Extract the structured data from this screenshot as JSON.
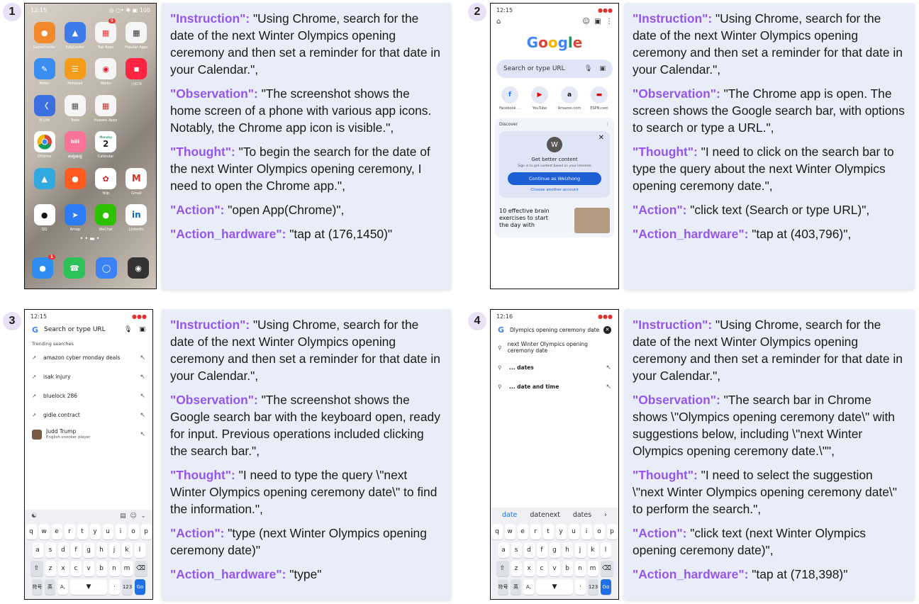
{
  "panels": [
    {
      "num": "1",
      "instruction": "\"Using Chrome, search for the date of the next Winter Olympics opening ceremony and then set a reminder for that date in your Calendar.\",",
      "observation": "\"The screenshot shows the home screen of a phone with various app icons. Notably, the Chrome app icon is visible.\",",
      "thought": "\"To begin the search for the date of the next Winter Olympics opening ceremony, I need to open the Chrome app.\",",
      "action": "\"open App(Chrome)\",",
      "action_hardware": "\"tap at (176,1450)\""
    },
    {
      "num": "2",
      "instruction": "\"Using Chrome, search for the date of the next Winter Olympics opening ceremony and then set a reminder for that date in your Calendar.\",",
      "observation": "\"The Chrome app is open. The screen shows the Google search bar, with options to search or type a URL.\",",
      "thought": "\"I need to click on the search bar to type the query about the next Winter Olympics opening ceremony date.\",",
      "action": "\"click text (Search or type URL)\",",
      "action_hardware": "\"tap at (403,796)\","
    },
    {
      "num": "3",
      "instruction": "\"Using Chrome, search for the date of the next Winter Olympics opening ceremony and then set a reminder for that date in your Calendar.\",",
      "observation": "\"The screenshot shows the Google search bar with the keyboard open, ready for input. Previous operations included clicking the search bar.\",",
      "thought": "\"I need to type the query \\\"next Winter Olympics opening ceremony date\\\" to find the information.\",",
      "action": "\"type (next Winter Olympics opening ceremony date)\"",
      "action_hardware": "\"type\""
    },
    {
      "num": "4",
      "instruction": "\"Using Chrome, search for the date of the next Winter Olympics opening ceremony and then set a reminder for that date in your Calendar.\",",
      "observation": "\"The search bar in Chrome shows \\\"Olympics opening ceremony date\\\" with suggestions below, including \\\"next Winter Olympics opening ceremony date.\\\"\",",
      "thought": "\"I need to select the suggestion \\\"next Winter Olympics opening ceremony date\\\" to perform the search.\",",
      "action": "\"click text (next Winter Olympics opening ceremony date)\",",
      "action_hardware": "\"tap at (718,398)\""
    }
  ],
  "labels": {
    "instruction": "\"Instruction\":",
    "observation": "\"Observation\":",
    "thought": "\"Thought\":",
    "action": "\"Action\":",
    "action_hardware": "\"Action_hardware\":"
  },
  "phone1": {
    "time": "12:15",
    "status_right": "◎ ○• ✱ ▣ 100",
    "apps": [
      "GameCenter",
      "EduCenter",
      "Top Apps",
      "Popular Apps",
      "Notes",
      "Notepad",
      "Weibo",
      "小红书",
      "AI Life",
      "Tools",
      "Huawei Apps",
      "",
      "Chrome",
      "哔哩哔哩",
      "Calendar",
      "",
      "",
      "",
      "Yelp",
      "Gmail",
      "QQ",
      "Amap",
      "WeChat",
      "LinkedIn"
    ],
    "calendar_day": "2",
    "calendar_weekday": "Monday",
    "badge": "9",
    "msg_badge": "1"
  },
  "phone2": {
    "time": "12:15",
    "search_placeholder": "Search or type URL",
    "shortcuts": [
      "Facebook ...",
      "YouTube",
      "Amazon.com",
      "ESPN.com"
    ],
    "discover": "Discover",
    "avatar_letter": "W",
    "get_better": "Get better content",
    "sign_in": "Sign in to get content based on your interests",
    "continue": "Continue as Weizhong",
    "choose": "Choose another account",
    "article": "10 effective brain exercises to start the day with"
  },
  "phone3": {
    "time": "12:15",
    "search_placeholder": "Search or type URL",
    "trending_title": "Trending searches",
    "trends": [
      "amazon cyber monday deals",
      "isak injury",
      "bluelock 286",
      "gidle contract"
    ],
    "person_name": "Judd Trump",
    "person_desc": "English snooker player",
    "kb_row1": [
      "q",
      "w",
      "e",
      "r",
      "t",
      "y",
      "u",
      "i",
      "o",
      "p"
    ],
    "kb_row2": [
      "a",
      "s",
      "d",
      "f",
      "g",
      "h",
      "j",
      "k",
      "l"
    ],
    "kb_row3": [
      "z",
      "x",
      "c",
      "v",
      "b",
      "n",
      "m"
    ],
    "kb_sym": "符号",
    "kb_lang": "英",
    "kb_num": "123",
    "kb_go": "Go"
  },
  "phone4": {
    "time": "12:16",
    "query": "Dlympics opening ceremony date",
    "suggestion_main": "next Winter Olympics opening ceremony date",
    "suggestion_2": "... dates",
    "suggestion_3": "... date and time",
    "candidates": [
      "date",
      "datenext",
      "dates"
    ],
    "kb_row1": [
      "q",
      "w",
      "e",
      "r",
      "t",
      "y",
      "u",
      "i",
      "o",
      "p"
    ],
    "kb_row2": [
      "a",
      "s",
      "d",
      "f",
      "g",
      "h",
      "j",
      "k",
      "l"
    ],
    "kb_row3": [
      "z",
      "x",
      "c",
      "v",
      "b",
      "n",
      "m"
    ],
    "kb_sym": "符号",
    "kb_lang": "英",
    "kb_num": "123",
    "kb_go": "Go"
  }
}
